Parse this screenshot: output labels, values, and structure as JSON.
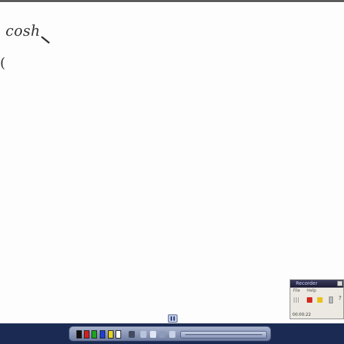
{
  "whiteboard": {
    "ink_text": "cosh",
    "ink_paren": "("
  },
  "toolbar": {
    "colors": [
      "#111111",
      "#d81b1b",
      "#1aa51a",
      "#1e3fd6",
      "#e8d51c",
      "#ffffff"
    ]
  },
  "recorder": {
    "title": "Recorder",
    "menu": [
      "File",
      "Help"
    ],
    "help_symbol": "?",
    "time": "00:00:22"
  }
}
